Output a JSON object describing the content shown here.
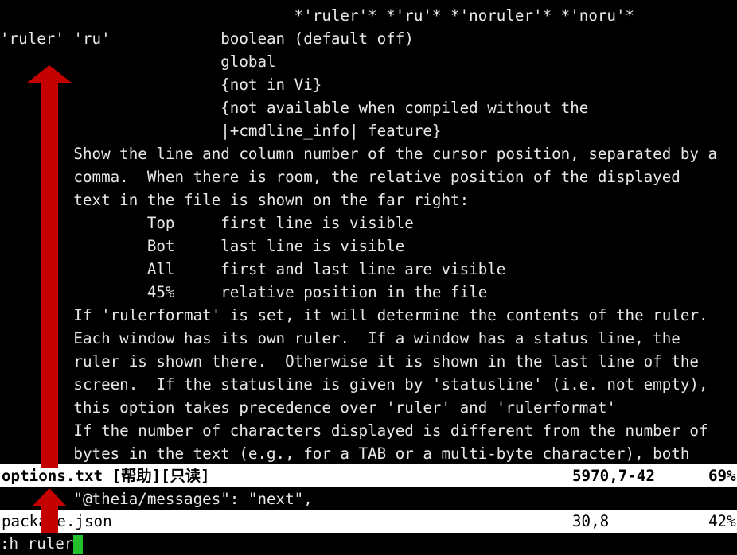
{
  "help_window": {
    "lines": [
      "                                *'ruler'* *'ru'* *'noruler'* *'noru'*",
      "'ruler' 'ru'            boolean (default off)",
      "                        global",
      "                        {not in Vi}",
      "                        {not available when compiled without the",
      "                        |+cmdline_info| feature}",
      "        Show the line and column number of the cursor position, separated by a",
      "        comma.  When there is room, the relative position of the displayed",
      "        text in the file is shown on the far right:",
      "                Top     first line is visible",
      "                Bot     last line is visible",
      "                All     first and last line are visible",
      "                45%     relative position in the file",
      "        If 'rulerformat' is set, it will determine the contents of the ruler.",
      "        Each window has its own ruler.  If a window has a status line, the",
      "        ruler is shown there.  Otherwise it is shown in the last line of the",
      "        screen.  If the statusline is given by 'statusline' (i.e. not empty),",
      "        this option takes precedence over 'ruler' and 'rulerformat'",
      "        If the number of characters displayed is different from the number of",
      "        bytes in the text (e.g., for a TAB or a multi-byte character), both"
    ],
    "status": {
      "filename": "options.txt [帮助][只读]",
      "position": "5970,7-42",
      "percent": "69%"
    }
  },
  "json_window": {
    "lines": [
      "        \"@theia/messages\": \"next\","
    ],
    "status": {
      "filename": "package.json",
      "position": "30,8",
      "percent": "42%"
    }
  },
  "command_line": {
    "text": ":h ruler"
  },
  "colors": {
    "background": "#000000",
    "text": "#e8e8e8",
    "statusline_bg": "#ffffff",
    "cursor": "#22c02a",
    "arrow": "#c40000"
  },
  "annotations": [
    {
      "icon": "up-arrow-icon",
      "meaning": "scroll up"
    },
    {
      "icon": "up-arrow-icon",
      "meaning": "scroll up"
    }
  ]
}
